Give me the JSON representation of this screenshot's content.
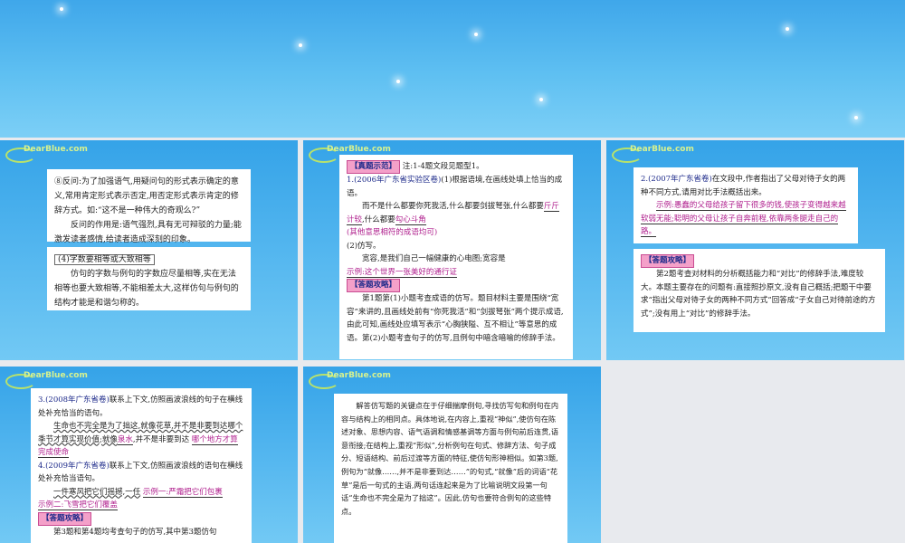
{
  "banner": {
    "description": ""
  },
  "slide1": {
    "p1": "⑧反问:为了加强语气,用疑问句的形式表示确定的意义,常用肯定形式表示否定,用否定形式表示肯定的修辞方式。如:“这不是一种伟大的奇观么?”",
    "p2": "反问的作用是:语气强烈,具有无可辩驳的力量;能激发读者感情,给读者造成深刻的印象。",
    "heading": "(4)字数要相等或大致相等",
    "p3": "仿句的字数与例句的字数应尽量相等,实在无法相等也要大致相等,不能相差太大,这样仿句与例句的结构才能是和谐匀称的。"
  },
  "slide2": {
    "tag": "【真题示范】",
    "note": "注:1-4题文段见题型1。",
    "q1_source": "1.(2006年广东省实验区卷)",
    "q1_text": "(1)根据语境,在画线处填上恰当的成语。",
    "q1_body1": "而不是什么都要你死我活,什么都要剑拔弩张,什么都要",
    "q1_ans1": "斤斤计较",
    "q1_body2": ",什么都要",
    "q1_ans2": "勾心斗角",
    "q1_note": "(其他意思相符的成语均可)",
    "q2_label": "(2)仿写。",
    "q2_body": "宽容,是我们自己一幅健康的心电图;宽容是",
    "q2_example": "示例:这个世界一张美好的通行证",
    "tag2": "【答题攻略】",
    "analysis": "第1题第(1)小题考查成语的仿写。题目材料主要是围绕“宽容”来讲的,且画线处前有“你死我活”和“剑拔弩张”两个提示成语,由此可知,画线处应填写表示“心胸狭隘、互不相让”等意思的成语。第(2)小题考查句子的仿写,且例句中暗含暗喻的修辞手法。"
  },
  "slide3": {
    "q_source": "2.(2007年广东省卷)",
    "q_text": "在文段中,作者指出了父母对待子女的两种不同方式,请用对比手法概括出来。",
    "example": "示例:愚蠢的父母给孩子留下很多的钱,使孩子变得越来越软弱无能;聪明的父母让孩子自奔前程,依靠两条腿走自己的路。",
    "tag": "【答题攻略】",
    "analysis": "第2题考查对材料的分析概括能力和“对比”的修辞手法,难度较大。本题主要存在的问题有:直接照抄原文,没有自己概括;把题干中要求“指出父母对待子女的两种不同方式”回答成“子女自己对待前途的方式”;没有用上“对比”的修辞手法。"
  },
  "slide4": {
    "q3_source": "3.(2008年广东省卷)",
    "q3_text": "联系上下文,仿照画波浪线的句子在横线处补充恰当的语句。",
    "q3_body1": "生命也不完全是为了拙这,就像花草,并不是非要到达哪个季节才算实现价值;就像",
    "q3_ans": "泉水",
    "q3_body2": ",并不是非要到达",
    "q3_ans2": "哪个地方才算完成使命",
    "q4_source": "4.(2009年广东省卷)",
    "q4_text": "联系上下文,仿照画波浪线的语句在横线处补充恰当语句。",
    "q4_body": "一件寒风把它们摇撼,一任",
    "q4_ex1": "示例一:严霜把它们包裹",
    "q4_ex2": "示例二:飞雪把它们覆盖",
    "tag": "【答题攻略】",
    "analysis": "第3题和第4题均考查句子的仿写,其中第3题仿句"
  },
  "slide5": {
    "analysis": "解答仿写题的关键点在于仔细揣摩例句,寻找仿写句和例句在内容与结构上的相同点。具体地说,在内容上,重视“神似”,使仿句在陈述对象、思想内容、语气语调和情感基调等方面与例句前后连贯,语意衔接;在结构上,重视“形似”,分析例句在句式、修辞方法、句子成分、短语结构、前后过渡等方面的特征,使仿句形神相似。如第3题,例句为“就像……,并不是非要到达……”的句式,“就像”后的词语“花草”是后一句式的主语,两句话连起来是为了比喻说明文段第一句话“生命也不完全是为了拙这”。因此,仿句也要符合例句的这些特点。"
  },
  "colors": {
    "slide_blue": "#3fa7ea",
    "tag_pink": "#f4a0c9",
    "answer_magenta": "#b0208e",
    "logo_green": "#b8e26b"
  },
  "logo": {
    "text": "DearBlue.com",
    "sub": ""
  }
}
